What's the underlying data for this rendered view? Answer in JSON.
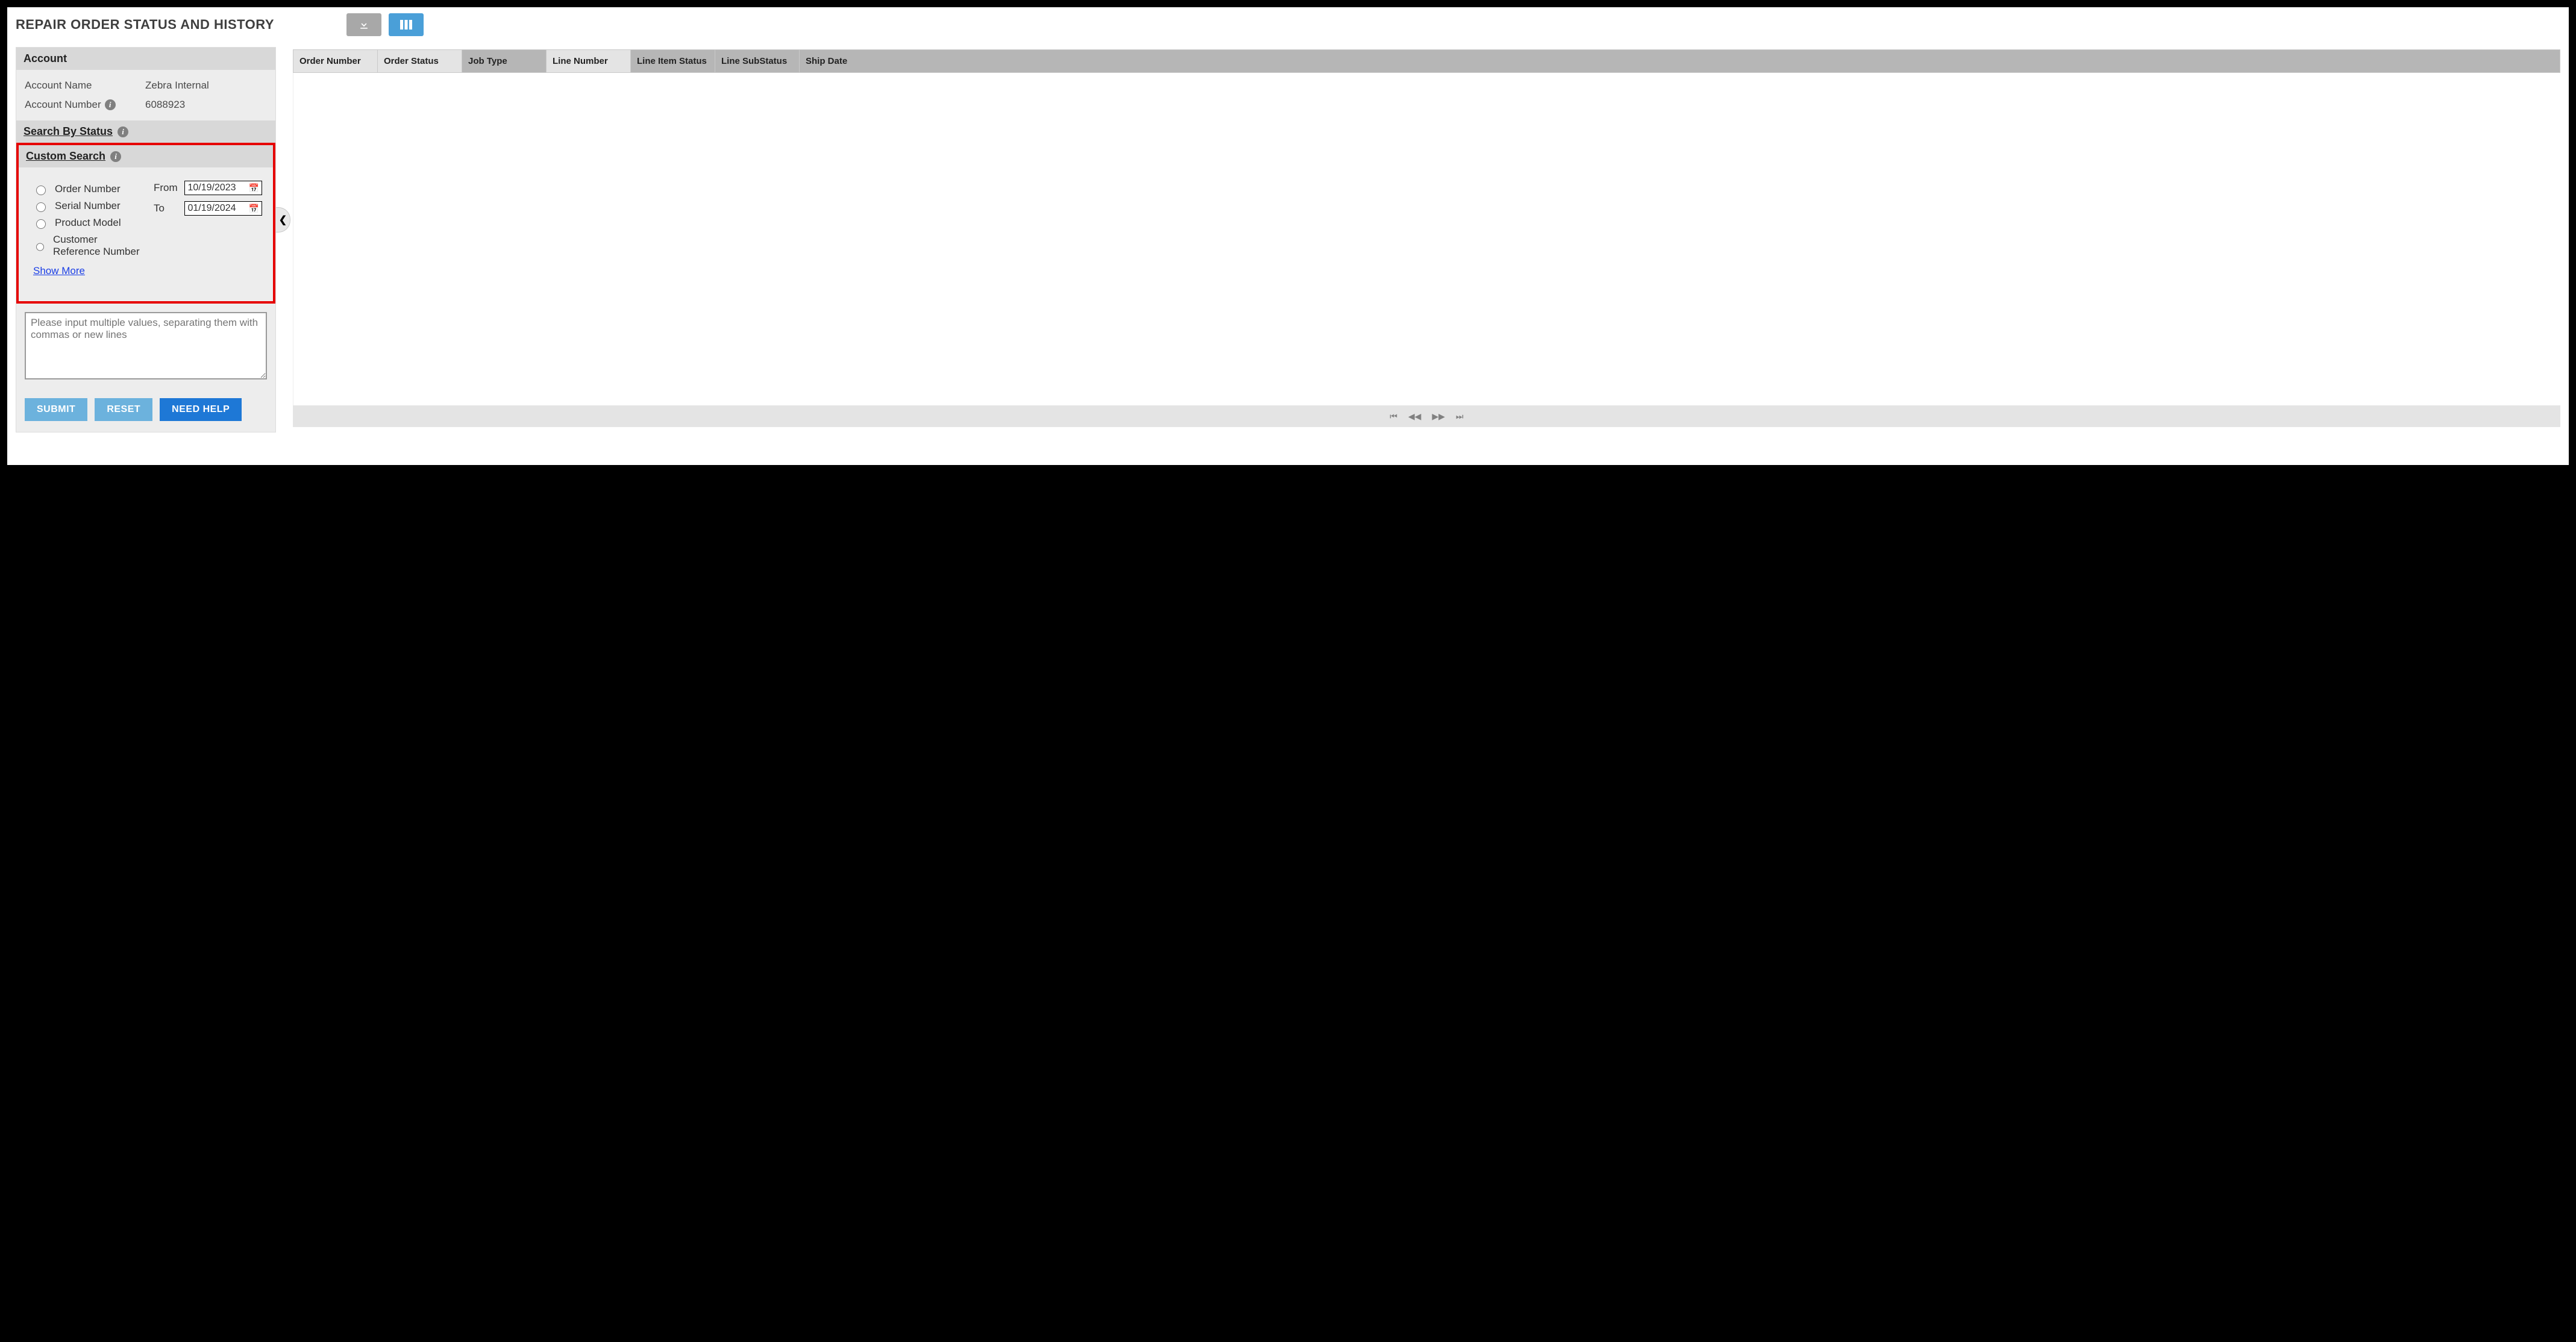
{
  "page_title": "REPAIR ORDER STATUS AND HISTORY",
  "account": {
    "header": "Account",
    "name_label": "Account Name",
    "name_value": "Zebra Internal",
    "number_label": "Account Number",
    "number_value": "6088923"
  },
  "search_by_status": {
    "header": "Search By Status"
  },
  "custom_search": {
    "header": "Custom Search",
    "options": [
      "Order Number",
      "Serial Number",
      "Product Model",
      "Customer Reference Number"
    ],
    "show_more": "Show More",
    "from_label": "From",
    "to_label": "To",
    "from_value": "10/19/2023",
    "to_value": "01/19/2024"
  },
  "multi_placeholder": "Please input multiple values, separating them with commas or new lines",
  "buttons": {
    "submit": "SUBMIT",
    "reset": "RESET",
    "help": "NEED HELP"
  },
  "grid": {
    "columns": [
      {
        "label": "Order Number",
        "shade": "light",
        "w": 140
      },
      {
        "label": "Order Status",
        "shade": "light",
        "w": 140
      },
      {
        "label": "Job Type",
        "shade": "dark",
        "w": 140
      },
      {
        "label": "Line Number",
        "shade": "light",
        "w": 140
      },
      {
        "label": "Line Item Status",
        "shade": "dark",
        "w": 140
      },
      {
        "label": "Line SubStatus",
        "shade": "dark",
        "w": 140
      },
      {
        "label": "Ship Date",
        "shade": "dark",
        "w": 0
      }
    ]
  },
  "info_glyph": "i",
  "collapse_glyph": "❮"
}
